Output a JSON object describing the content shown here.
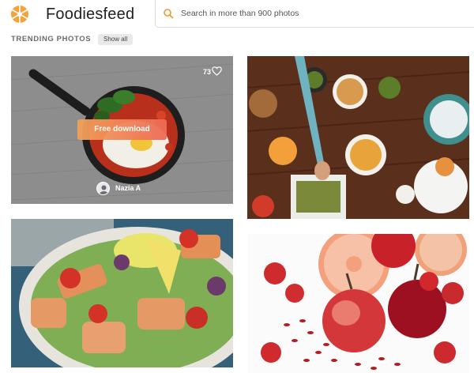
{
  "app": {
    "brand": "Foodiesfeed",
    "logo": "orange-sun-logo-icon"
  },
  "search": {
    "placeholder": "Search in more than 900 photos",
    "value": "",
    "icon": "search-icon"
  },
  "section": {
    "title": "TRENDING PHOTOS",
    "show_all": "Show all"
  },
  "photos": [
    {
      "subject": "skillet with eggs and tomato sauce",
      "likes": "73",
      "download_label": "Free download",
      "author": "Nazia A",
      "icon": "heart-icon"
    },
    {
      "subject": "overhead table with many dishes"
    },
    {
      "subject": "salmon salad with lemon"
    },
    {
      "subject": "apples grapefruit strawberries goji berries"
    }
  ],
  "colors": {
    "accent": "#f09a2e",
    "download_start": "#f2a25a",
    "download_end": "#ee6a55"
  }
}
